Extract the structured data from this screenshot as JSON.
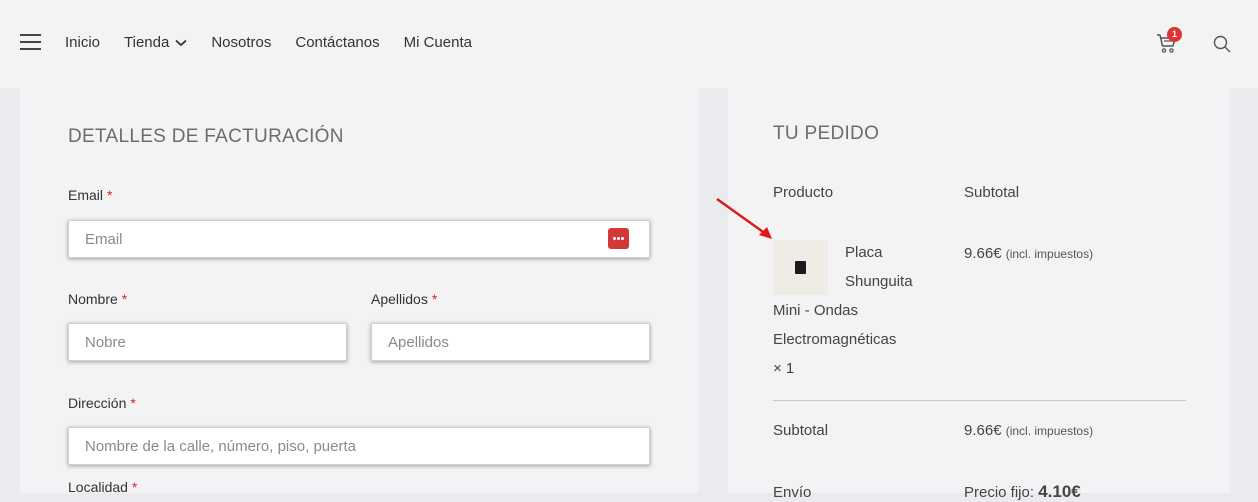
{
  "header": {
    "nav": [
      {
        "label": "Inicio"
      },
      {
        "label": "Tienda"
      },
      {
        "label": "Nosotros"
      },
      {
        "label": "Contáctanos"
      },
      {
        "label": "Mi Cuenta"
      }
    ],
    "cart_count": "1"
  },
  "billing": {
    "title": "DETALLES DE FACTURACIÓN",
    "required_mark": "*",
    "email": {
      "label": "Email",
      "placeholder": "Email",
      "value": ""
    },
    "first_name": {
      "label": "Nombre",
      "placeholder": "Nobre",
      "value": ""
    },
    "last_name": {
      "label": "Apellidos",
      "placeholder": "Apellidos",
      "value": ""
    },
    "address": {
      "label": "Dirección",
      "placeholder": "Nombre de la calle, número, piso, puerta",
      "value": ""
    },
    "city": {
      "label": "Localidad"
    }
  },
  "order": {
    "title": "TU PEDIDO",
    "col_product": "Producto",
    "col_subtotal": "Subtotal",
    "item": {
      "name_lines": [
        "Placa",
        "Shunguita",
        "Mini - Ondas",
        "Electromagnéticas"
      ],
      "quantity": "× 1",
      "price": "9.66€",
      "tax_note": "(incl. impuestos)"
    },
    "subtotal": {
      "label": "Subtotal",
      "price": "9.66€",
      "tax_note": "(incl. impuestos)"
    },
    "shipping": {
      "label": "Envío",
      "text": "Precio fijo:",
      "price": "4.10€"
    }
  },
  "colors": {
    "accent": "#dd3333",
    "panel_bg": "#f3f3f5",
    "page_bg": "#eaebee"
  },
  "icons": {
    "menu": "hamburger-icon",
    "chevron": "chevron-down-icon",
    "cart": "cart-icon",
    "search": "search-icon",
    "password_manager": "password-manager-icon"
  }
}
